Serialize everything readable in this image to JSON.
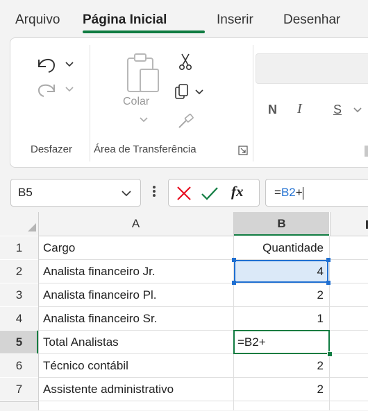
{
  "tabs": [
    "Arquivo",
    "Página Inicial",
    "Inserir",
    "Desenhar"
  ],
  "ribbon": {
    "undo_group_label": "Desfazer",
    "clipboard_group_label": "Área de Transferência",
    "paste_label": "Colar",
    "bold": "N",
    "italic": "I",
    "underline": "S"
  },
  "formula_bar": {
    "name_box": "B5",
    "fx": "fx",
    "formula_prefix": "=",
    "formula_ref": "B2",
    "formula_suffix": "+"
  },
  "columns": [
    "A",
    "B"
  ],
  "rows": [
    {
      "n": "1",
      "a": "Cargo",
      "b": "Quantidade"
    },
    {
      "n": "2",
      "a": "Analista financeiro Jr.",
      "b": "4"
    },
    {
      "n": "3",
      "a": "Analista financeiro Pl.",
      "b": "2"
    },
    {
      "n": "4",
      "a": "Analista financeiro Sr.",
      "b": "1"
    },
    {
      "n": "5",
      "a": "Total Analistas",
      "b": "=B2+"
    },
    {
      "n": "6",
      "a": "Técnico contábil",
      "b": "2"
    },
    {
      "n": "7",
      "a": "Assistente administrativo",
      "b": "2"
    }
  ],
  "colors": {
    "accent": "#107c41",
    "ref": "#1f6fd1",
    "cancel": "#e81123"
  }
}
